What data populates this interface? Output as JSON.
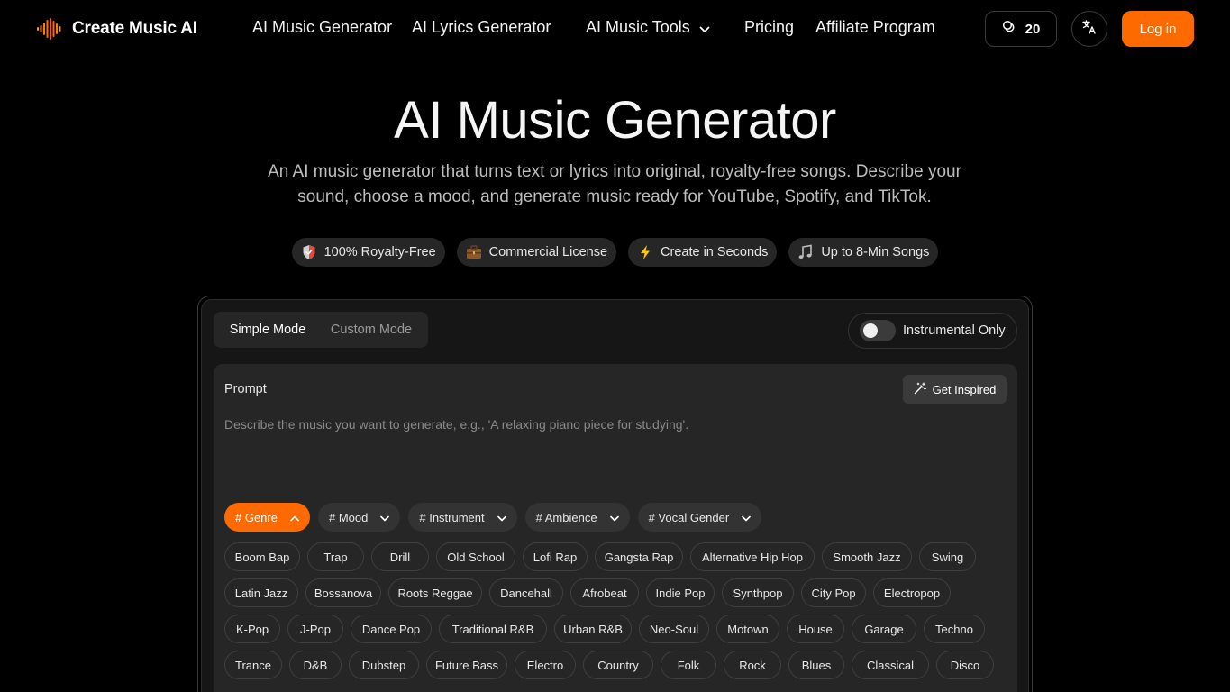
{
  "nav": {
    "brand": "Create Music AI",
    "links": [
      "AI Music Generator",
      "AI Lyrics Generator",
      "AI Music Tools",
      "Pricing",
      "Affiliate Program"
    ],
    "credits": "20",
    "login": "Log in"
  },
  "hero": {
    "title": "AI Music Generator",
    "subtitle": "An AI music generator that turns text or lyrics into original, royalty-free songs. Describe your sound, choose a mood, and generate music ready for YouTube, Spotify, and TikTok.",
    "badges": [
      {
        "icon": "shield-icon",
        "label": "100% Royalty-Free"
      },
      {
        "icon": "briefcase-icon",
        "label": "Commercial License"
      },
      {
        "icon": "lightning-icon",
        "label": "Create in Seconds"
      },
      {
        "icon": "music-note-icon",
        "label": "Up to 8-Min Songs"
      }
    ]
  },
  "generator": {
    "modes": [
      "Simple Mode",
      "Custom Mode"
    ],
    "active_mode": "Simple Mode",
    "instrumental_label": "Instrumental Only",
    "instrumental_on": false,
    "prompt_label": "Prompt",
    "inspire_label": "Get Inspired",
    "prompt_placeholder": "Describe the music you want to generate, e.g., 'A relaxing piano piece for studying'.",
    "prompt_value": "",
    "categories": [
      "# Genre",
      "# Mood",
      "# Instrument",
      "# Ambience",
      "# Vocal Gender"
    ],
    "active_category": "# Genre",
    "genre_rows": [
      [
        "Boom Bap",
        "Trap",
        "Drill",
        "Old School",
        "Lofi Rap",
        "Gangsta Rap",
        "Alternative Hip Hop",
        "Smooth Jazz",
        "Swing"
      ],
      [
        "Latin Jazz",
        "Bossanova",
        "Roots Reggae",
        "Dancehall",
        "Afrobeat",
        "Indie Pop",
        "Synthpop",
        "City Pop",
        "Electropop"
      ],
      [
        "K-Pop",
        "J-Pop",
        "Dance Pop",
        "Traditional R&B",
        "Urban R&B",
        "Neo-Soul",
        "Motown",
        "House",
        "Garage",
        "Techno"
      ],
      [
        "Trance",
        "D&B",
        "Dubstep",
        "Future Bass",
        "Electro",
        "Country",
        "Folk",
        "Rock",
        "Blues",
        "Classical",
        "Disco"
      ]
    ]
  },
  "colors": {
    "accent": "#ff6a00",
    "background": "#000000",
    "panel": "#262626"
  }
}
